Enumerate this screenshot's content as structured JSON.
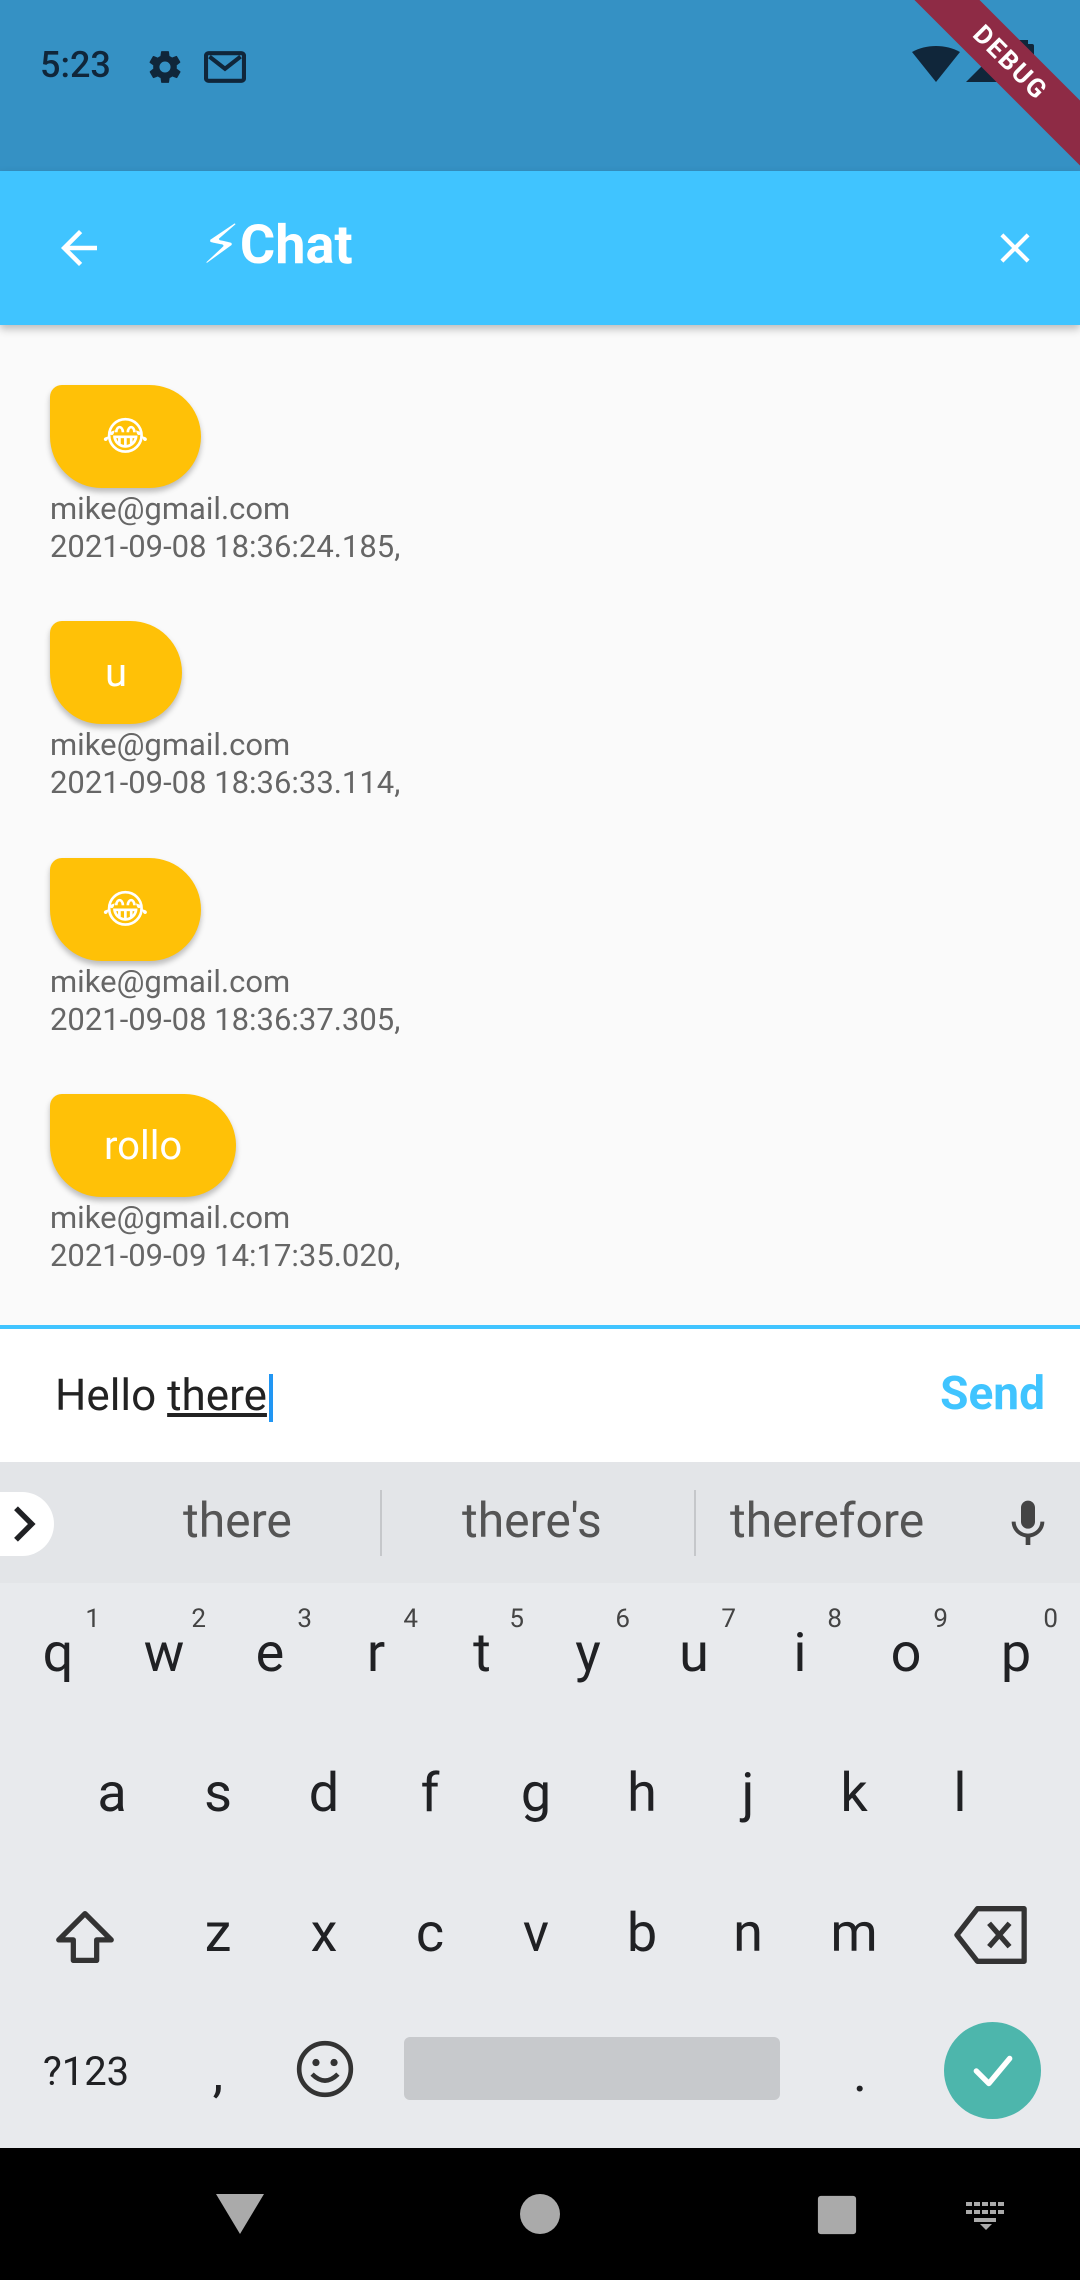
{
  "status_bar": {
    "time": "5:23",
    "icons": [
      "settings-icon",
      "mail-icon",
      "wifi-icon",
      "signal-icon",
      "battery-icon"
    ],
    "debug_label": "DEBUG"
  },
  "app_bar": {
    "title_emoji": "⚡",
    "title": "Chat",
    "color": "#40c4ff"
  },
  "messages": [
    {
      "text": "😂",
      "sender": "mike@gmail.com",
      "timestamp": "2021-09-08 18:36:24.185,"
    },
    {
      "text": "u",
      "sender": "mike@gmail.com",
      "timestamp": "2021-09-08 18:36:33.114,"
    },
    {
      "text": "😂",
      "sender": "mike@gmail.com",
      "timestamp": "2021-09-08 18:36:37.305,"
    },
    {
      "text": "rollo",
      "sender": "mike@gmail.com",
      "timestamp": "2021-09-09 14:17:35.020,"
    }
  ],
  "input": {
    "prefix": "Hello ",
    "composing": "there",
    "send_label": "Send"
  },
  "keyboard": {
    "suggestions": [
      "there",
      "there's",
      "therefore"
    ],
    "row1": [
      {
        "k": "q",
        "n": "1"
      },
      {
        "k": "w",
        "n": "2"
      },
      {
        "k": "e",
        "n": "3"
      },
      {
        "k": "r",
        "n": "4"
      },
      {
        "k": "t",
        "n": "5"
      },
      {
        "k": "y",
        "n": "6"
      },
      {
        "k": "u",
        "n": "7"
      },
      {
        "k": "i",
        "n": "8"
      },
      {
        "k": "o",
        "n": "9"
      },
      {
        "k": "p",
        "n": "0"
      }
    ],
    "row2": [
      "a",
      "s",
      "d",
      "f",
      "g",
      "h",
      "j",
      "k",
      "l"
    ],
    "row3": [
      "z",
      "x",
      "c",
      "v",
      "b",
      "n",
      "m"
    ],
    "symbols_label": "?123",
    "comma": ",",
    "period": ".",
    "accent": "#4db6ac"
  }
}
